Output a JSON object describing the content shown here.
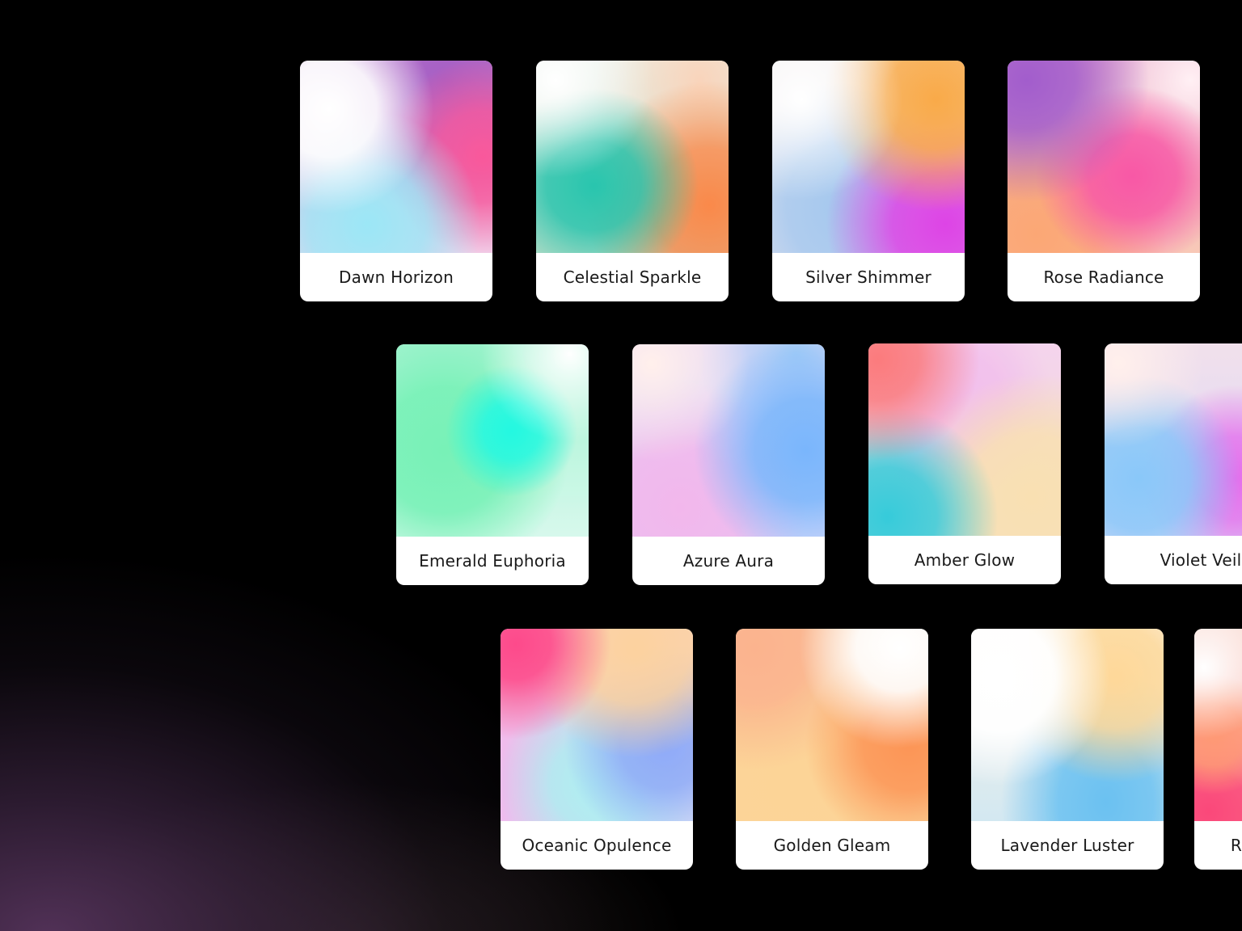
{
  "cards": [
    {
      "label": "Dawn Horizon"
    },
    {
      "label": "Celestial Sparkle"
    },
    {
      "label": "Silver Shimmer"
    },
    {
      "label": "Rose Radiance"
    },
    {
      "label": "Emerald Euphoria"
    },
    {
      "label": "Azure Aura"
    },
    {
      "label": "Amber Glow"
    },
    {
      "label": "Violet Veil"
    },
    {
      "label": "Oceanic Opulence"
    },
    {
      "label": "Golden Gleam"
    },
    {
      "label": "Lavender Luster"
    },
    {
      "label": "R"
    }
  ],
  "colors": {
    "background": "#000000",
    "card": "#ffffff",
    "label_text": "#1a1a1a"
  }
}
